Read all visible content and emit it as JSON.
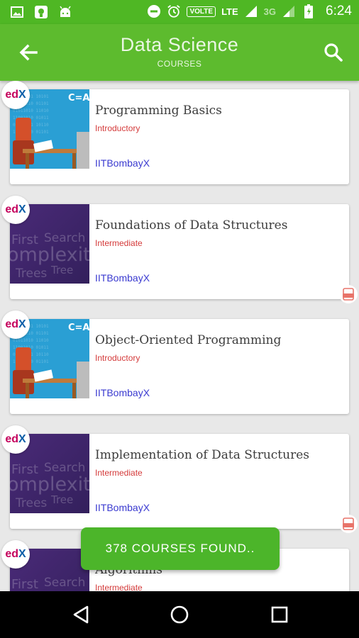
{
  "status_bar": {
    "network_lte": "LTE",
    "network_3g": "3G",
    "volte": "VOLTE",
    "time": "6:24",
    "left_icons": [
      "image-icon",
      "app-notification-icon",
      "android-icon"
    ],
    "right_icons": [
      "do-not-disturb-icon",
      "alarm-icon",
      "signal-icon",
      "battery-icon"
    ]
  },
  "app_bar": {
    "title": "Data Science",
    "subtitle": "COURSES",
    "back_icon": "arrow-back-icon",
    "search_icon": "search-icon"
  },
  "courses": [
    {
      "title": "Programming Basics",
      "level": "Introductory",
      "org": "IITBombayX",
      "provider_badge": {
        "e": "ed",
        "x": "X"
      },
      "thumb": "blue",
      "pdf": false
    },
    {
      "title": "Foundations of Data Structures",
      "level": "Intermediate",
      "org": "IITBombayX",
      "provider_badge": {
        "e": "ed",
        "x": "X"
      },
      "thumb": "purple",
      "pdf": true
    },
    {
      "title": "Object-Oriented Programming",
      "level": "Introductory",
      "org": "IITBombayX",
      "provider_badge": {
        "e": "ed",
        "x": "X"
      },
      "thumb": "blue",
      "pdf": false
    },
    {
      "title": "Implementation of Data Structures",
      "level": "Intermediate",
      "org": "IITBombayX",
      "provider_badge": {
        "e": "ed",
        "x": "X"
      },
      "thumb": "purple",
      "pdf": true
    },
    {
      "title": "Algorithms",
      "level": "Intermediate",
      "org": "",
      "provider_badge": {
        "e": "ed",
        "x": "X"
      },
      "thumb": "purple",
      "pdf": false
    }
  ],
  "thumb_text": {
    "blue_formula": "C=A",
    "purple_words": [
      "First",
      "Search",
      "omplexit",
      "Tree",
      "Trees"
    ]
  },
  "toast": {
    "text": "378 COURSES FOUND.."
  },
  "nav_bar": {
    "icons": [
      "back-triangle-icon",
      "home-circle-icon",
      "recents-square-icon"
    ]
  },
  "colors": {
    "primary": "#5dbb2e",
    "status_bar": "#4fb724",
    "level_text": "#d43a3a",
    "org_text": "#3a3ad0",
    "toast": "#4cb52a"
  }
}
